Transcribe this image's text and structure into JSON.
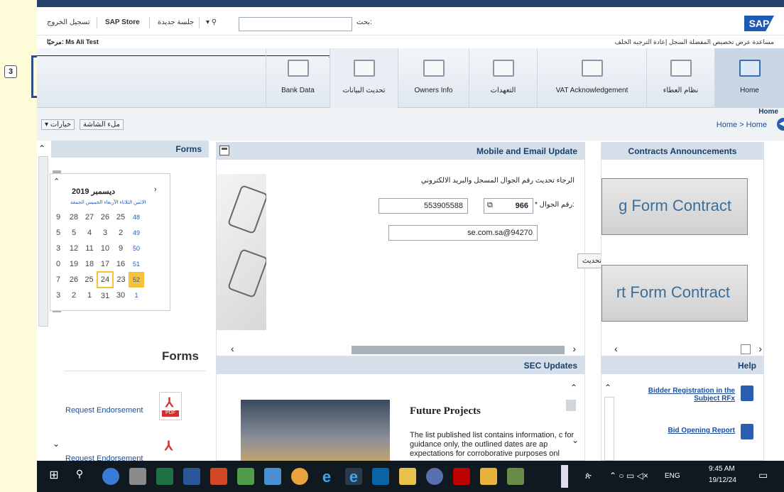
{
  "annotation": {
    "marker": "3"
  },
  "header": {
    "logout": "تسجيل الخروج",
    "store": "SAP Store",
    "new_session": "جلسة جديدة",
    "search_label": "بحث:",
    "logo": "SAP",
    "welcome": "مرحبًا: Ms Ali Test",
    "util_links": [
      "الخلف",
      "إعادة الترجيه",
      "السجل",
      "المفضلة",
      "تخصيص",
      "عرض",
      "مساعدة"
    ]
  },
  "nav": {
    "items": [
      {
        "label": "Bank Data"
      },
      {
        "label": "تحديث البيانات"
      },
      {
        "label": "Owners Info"
      },
      {
        "label": "التعهدات"
      },
      {
        "label": "VAT Acknowledgement"
      },
      {
        "label": "نظام العطاء"
      },
      {
        "label": "Home"
      }
    ],
    "home_sub": "Home"
  },
  "crumb": {
    "path": "Home > Home",
    "options": "خيارات",
    "fullscreen": "ملء الشاشة"
  },
  "forms_panel": {
    "title": "Forms",
    "cal_month": "ديسمبر",
    "cal_year": "2019",
    "cal_week_header": "الاثنين الثلاثاء الأربعاء الخميس الجمعة",
    "cal_rows": [
      [
        "9",
        "28",
        "27",
        "26",
        "25",
        "48"
      ],
      [
        "5",
        "5",
        "4",
        "3",
        "2",
        "49"
      ],
      [
        "3",
        "12",
        "11",
        "10",
        "9",
        "50"
      ],
      [
        "0",
        "19",
        "18",
        "17",
        "16",
        "51"
      ],
      [
        "7",
        "26",
        "25",
        "24",
        "23",
        "52"
      ],
      [
        "3",
        "2",
        "1",
        "31",
        "30",
        "1"
      ]
    ],
    "subtitle": "Forms",
    "link1": "Request Endorsement",
    "link2": "Request Endorsement"
  },
  "mobile_panel": {
    "title": "Mobile and Email Update",
    "instruction": "الرجاء تحديث رقم الجوال المسجل والبريد الالكتروني",
    "mobile_label": "* رقم الجوال:",
    "country_code": "966",
    "mobile_value": "553905588",
    "email_value": "se.com.sa@94270",
    "update_btn": "تحديث"
  },
  "sec_panel": {
    "title": "SEC Updates",
    "heading": "Future Projects",
    "body": "The list published list contains information, c for guidance only, the outlined dates are ap expectations for corroborative purposes onl"
  },
  "contracts_panel": {
    "title": "Contracts Announcements",
    "c1": "g Form Contract",
    "c2": "rt Form Contract"
  },
  "help_panel": {
    "title": "Help",
    "l1": "Bidder Registration in the Subject RFx",
    "l2": "Bid Opening Report"
  },
  "taskbar": {
    "lang": "ENG",
    "time": "9:45 AM",
    "date": "19/12/24"
  }
}
